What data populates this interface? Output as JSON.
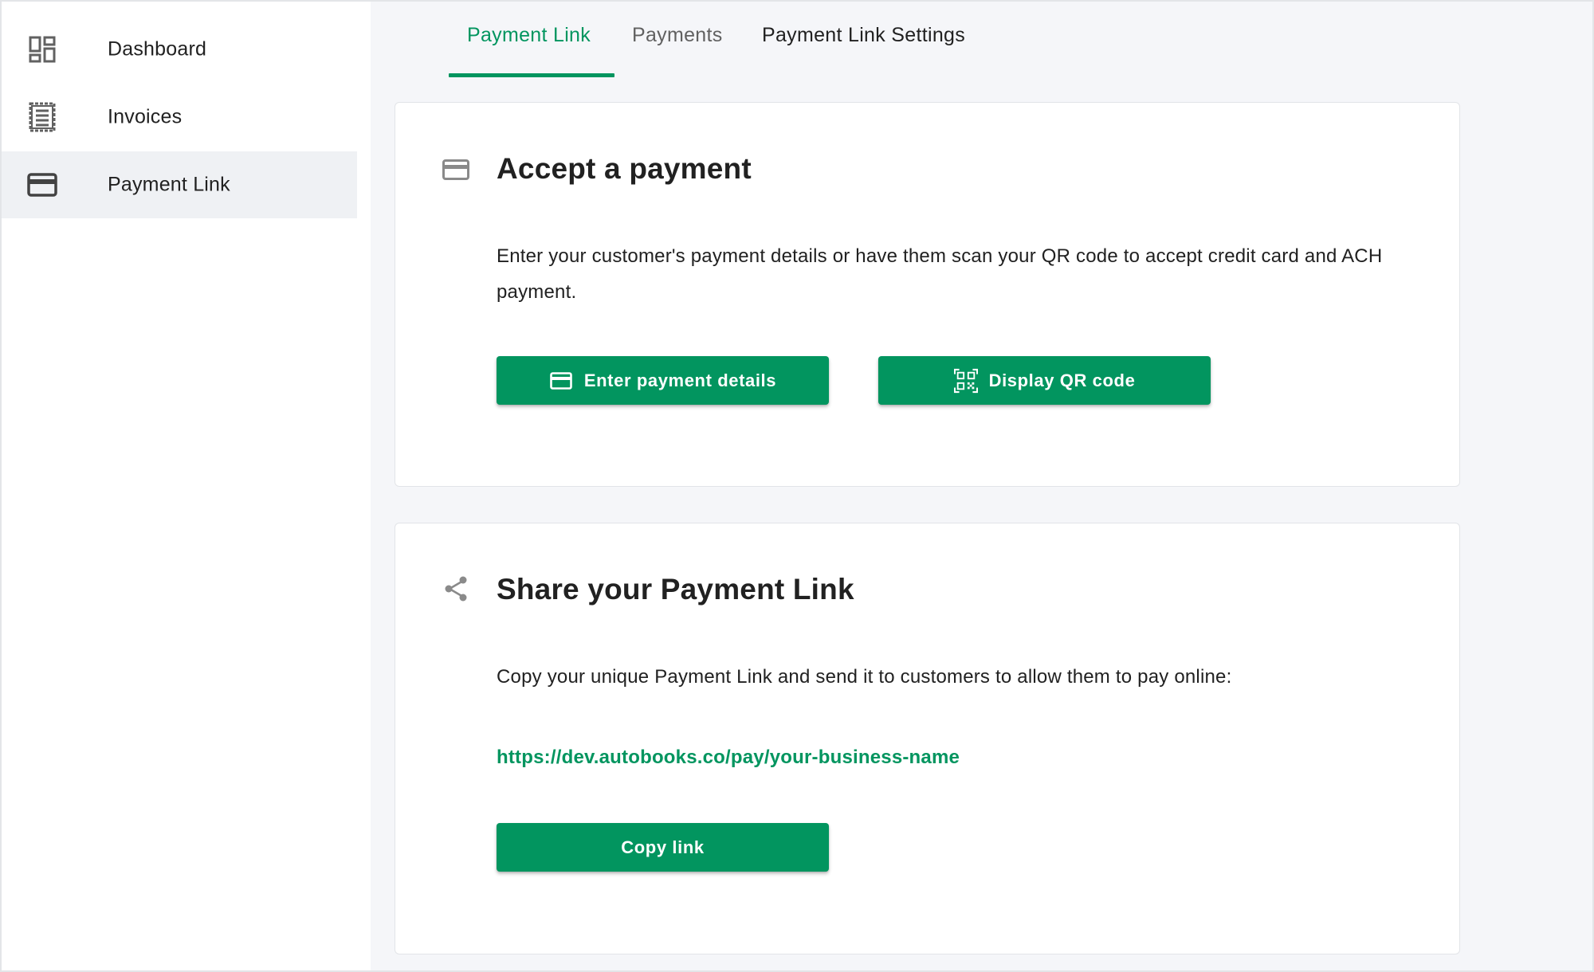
{
  "sidebar": {
    "items": [
      {
        "label": "Dashboard",
        "icon": "dashboard-icon",
        "active": false
      },
      {
        "label": "Invoices",
        "icon": "receipt-icon",
        "active": false
      },
      {
        "label": "Payment Link",
        "icon": "credit-card-icon",
        "active": true
      }
    ]
  },
  "tabs": [
    {
      "label": "Payment Link",
      "active": true
    },
    {
      "label": "Payments",
      "active": false
    },
    {
      "label": "Payment Link Settings",
      "active": false
    }
  ],
  "accept_card": {
    "icon": "credit-card-icon",
    "title": "Accept a payment",
    "description": "Enter your customer's payment details or have them scan your QR code to accept credit card and ACH payment.",
    "enter_details_label": "Enter payment details",
    "display_qr_label": "Display QR code"
  },
  "share_card": {
    "icon": "share-icon",
    "title": "Share your Payment Link",
    "description": "Copy your unique Payment Link and send it to customers to allow them to pay online:",
    "link": "https://dev.autobooks.co/pay/your-business-name",
    "copy_label": "Copy link"
  },
  "colors": {
    "accent": "#02955f",
    "sidebar_active_bg": "#eff1f4",
    "main_bg": "#f5f6f9",
    "text": "#212121",
    "muted_text": "#616161",
    "icon_gray": "#616161"
  }
}
